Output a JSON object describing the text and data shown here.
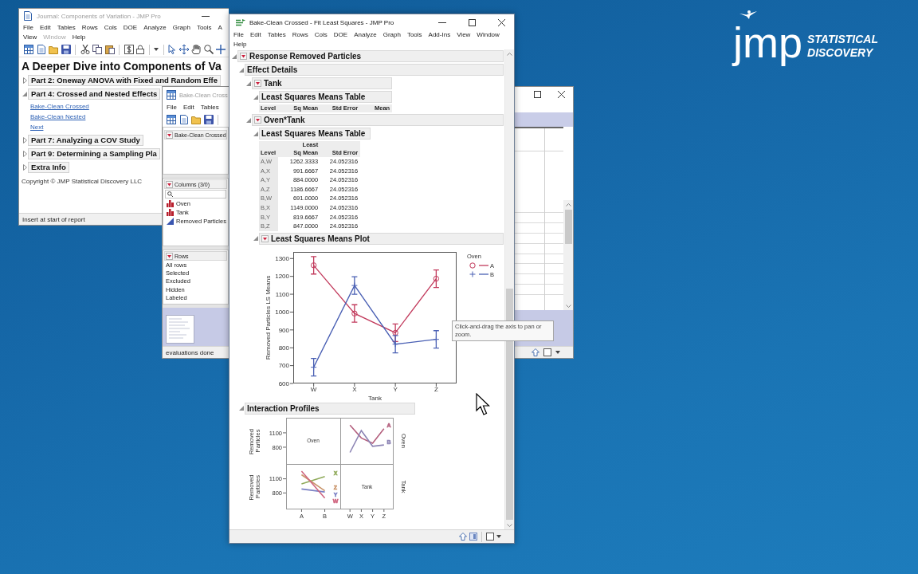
{
  "desktop": {
    "logo": {
      "wordmark": "jmp",
      "tagline": [
        "STATISTICAL",
        "DISCOVERY"
      ]
    }
  },
  "journal_window": {
    "title": "Journal: Components of Variation - JMP Pro",
    "active": false,
    "menu": [
      [
        {
          "label": "File",
          "disabled": false
        },
        {
          "label": "Edit",
          "disabled": false
        },
        {
          "label": "Tables",
          "disabled": false
        },
        {
          "label": "Rows",
          "disabled": false
        },
        {
          "label": "Cols",
          "disabled": false
        },
        {
          "label": "DOE",
          "disabled": false
        },
        {
          "label": "Analyze",
          "disabled": false
        },
        {
          "label": "Graph",
          "disabled": false
        },
        {
          "label": "Tools",
          "disabled": false
        },
        {
          "label": "A",
          "disabled": false
        }
      ],
      [
        {
          "label": "View",
          "disabled": false
        },
        {
          "label": "Window",
          "disabled": true
        },
        {
          "label": "Help",
          "disabled": false
        }
      ]
    ],
    "heading": "A Deeper Dive into Components of Va",
    "outline": [
      {
        "title": "Part 2: Oneway ANOVA with Fixed and Random Effe",
        "expanded": false
      },
      {
        "title": "Part 4: Crossed and Nested Effects",
        "expanded": true,
        "links": [
          "Bake-Clean Crossed",
          "Bake-Clean Nested",
          "Next"
        ]
      },
      {
        "title": "Part 7: Analyzing a COV Study",
        "expanded": false
      },
      {
        "title": "Part 9: Determining a Sampling Pla",
        "expanded": false
      },
      {
        "title": "Extra Info",
        "expanded": false
      }
    ],
    "copyright": "Copyright © JMP Statistical Discovery LLC",
    "status_bar": "Insert at start of report"
  },
  "data_table_window": {
    "title": "Bake-Clean Cross",
    "active": false,
    "menu": [
      [
        {
          "label": "File",
          "disabled": false
        },
        {
          "label": "Edit",
          "disabled": false
        },
        {
          "label": "Tables",
          "disabled": false
        }
      ]
    ],
    "table_panel": {
      "title": "Bake-Clean Crossed"
    },
    "columns_panel": {
      "title": "Columns (3/0)",
      "columns": [
        {
          "name": "Oven",
          "kind": "nominal"
        },
        {
          "name": "Tank",
          "kind": "nominal"
        },
        {
          "name": "Removed Particles",
          "kind": "continuous"
        }
      ]
    },
    "rows_panel": {
      "title": "Rows",
      "items": [
        "All rows",
        "Selected",
        "Excluded",
        "Hidden",
        "Labeled"
      ]
    },
    "status_bar": "evaluations done"
  },
  "report_window": {
    "title": "Bake-Clean Crossed - Fit Least Squares - JMP Pro",
    "active": true,
    "menu": [
      [
        {
          "label": "File",
          "disabled": false
        },
        {
          "label": "Edit",
          "disabled": false
        },
        {
          "label": "Tables",
          "disabled": false
        },
        {
          "label": "Rows",
          "disabled": false
        },
        {
          "label": "Cols",
          "disabled": false
        },
        {
          "label": "DOE",
          "disabled": false
        },
        {
          "label": "Analyze",
          "disabled": false
        },
        {
          "label": "Graph",
          "disabled": false
        },
        {
          "label": "Tools",
          "disabled": false
        },
        {
          "label": "Add-Ins",
          "disabled": false
        },
        {
          "label": "View",
          "disabled": false
        },
        {
          "label": "Window",
          "disabled": false
        }
      ],
      [
        {
          "label": "Help",
          "disabled": false
        }
      ]
    ],
    "report": {
      "kind": "node",
      "title": "Response Removed Particles",
      "expanded": true,
      "menu": true,
      "children": [
        {
          "kind": "node",
          "title": "Effect Details",
          "expanded": true,
          "menu": false,
          "children": [
            {
              "kind": "node",
              "title": "Tank",
              "expanded": true,
              "menu": true,
              "children": [
                {
                  "kind": "node",
                  "title": "Least Squares Means Table",
                  "expanded": true,
                  "menu": false,
                  "children": [
                    {
                      "kind": "table",
                      "columns": [
                        "Level",
                        "Sq Mean",
                        "Std Error",
                        "Mean"
                      ]
                    }
                  ]
                }
              ]
            },
            {
              "kind": "node",
              "title": "Oven*Tank",
              "expanded": true,
              "menu": true,
              "children": [
                {
                  "kind": "node",
                  "title": "Least Squares Means Table",
                  "expanded": true,
                  "menu": false,
                  "children": [
                    {
                      "kind": "table",
                      "columns": [
                        "Level",
                        "Least\nSq Mean",
                        "Std Error"
                      ],
                      "rows": [
                        [
                          "A,W",
                          "1262.3333",
                          "24.052316"
                        ],
                        [
                          "A,X",
                          "991.6667",
                          "24.052316"
                        ],
                        [
                          "A,Y",
                          "884.0000",
                          "24.052316"
                        ],
                        [
                          "A,Z",
                          "1186.6667",
                          "24.052316"
                        ],
                        [
                          "B,W",
                          "691.0000",
                          "24.052316"
                        ],
                        [
                          "B,X",
                          "1149.0000",
                          "24.052316"
                        ],
                        [
                          "B,Y",
                          "819.6667",
                          "24.052316"
                        ],
                        [
                          "B,Z",
                          "847.0000",
                          "24.052316"
                        ]
                      ]
                    }
                  ]
                },
                {
                  "kind": "node",
                  "title": "Least Squares Means Plot",
                  "expanded": true,
                  "menu": true,
                  "children": [
                    {
                      "kind": "plot",
                      "chart_data": {
                        "type": "line",
                        "xlabel": "Tank",
                        "ylabel": "Removed Particles LS Means",
                        "categories": [
                          "W",
                          "X",
                          "Y",
                          "Z"
                        ],
                        "series": [
                          {
                            "name": "A",
                            "color": "#c23a5c",
                            "marker": "circle",
                            "values": [
                              1262,
                              992,
                              884,
                              1187
                            ],
                            "errors": [
                              49,
                              49,
                              49,
                              49
                            ]
                          },
                          {
                            "name": "B",
                            "color": "#4a60b4",
                            "marker": "plus",
                            "values": [
                              691,
                              1149,
                              820,
                              847
                            ],
                            "errors": [
                              49,
                              49,
                              49,
                              49
                            ]
                          }
                        ],
                        "ylim": [
                          600,
                          1337
                        ],
                        "yticks": [
                          600,
                          700,
                          800,
                          900,
                          1000,
                          1100,
                          1200,
                          1300
                        ],
                        "legend": {
                          "title": "Oven"
                        }
                      }
                    }
                  ]
                }
              ]
            }
          ]
        },
        {
          "kind": "node",
          "title": "Interaction Profiles",
          "expanded": true,
          "menu": false,
          "children": [
            {
              "kind": "profiles",
              "rows": [
                {
                  "y_title": "Removed Particles",
                  "y_ticks": [
                    "1100",
                    "800"
                  ],
                  "row_label": "Oven"
                },
                {
                  "y_title": "Removed Particles",
                  "y_ticks": [
                    "1100",
                    "800"
                  ],
                  "row_label": "Tank"
                }
              ],
              "cells": [
                {
                  "kind": "label",
                  "text": "Oven"
                },
                {
                  "kind": "lines",
                  "labels": [
                    {
                      "text": "A",
                      "color": "#b4607e"
                    },
                    {
                      "text": "B",
                      "color": "#8c84b4"
                    }
                  ]
                },
                {
                  "kind": "lines",
                  "labels": [
                    {
                      "text": "X",
                      "color": "#8faa5a"
                    },
                    {
                      "text": "Z",
                      "color": "#c9946a"
                    },
                    {
                      "text": "Y",
                      "color": "#7b80c4"
                    },
                    {
                      "text": "W",
                      "color": "#d06680"
                    }
                  ]
                },
                {
                  "kind": "label",
                  "text": "Tank"
                }
              ],
              "x_labels": [
                [
                  "A",
                  "B"
                ],
                [
                  "W",
                  "X",
                  "Y",
                  "Z"
                ]
              ]
            }
          ]
        }
      ]
    }
  },
  "tooltip": "Click-and-drag the axis to pan or zoom."
}
